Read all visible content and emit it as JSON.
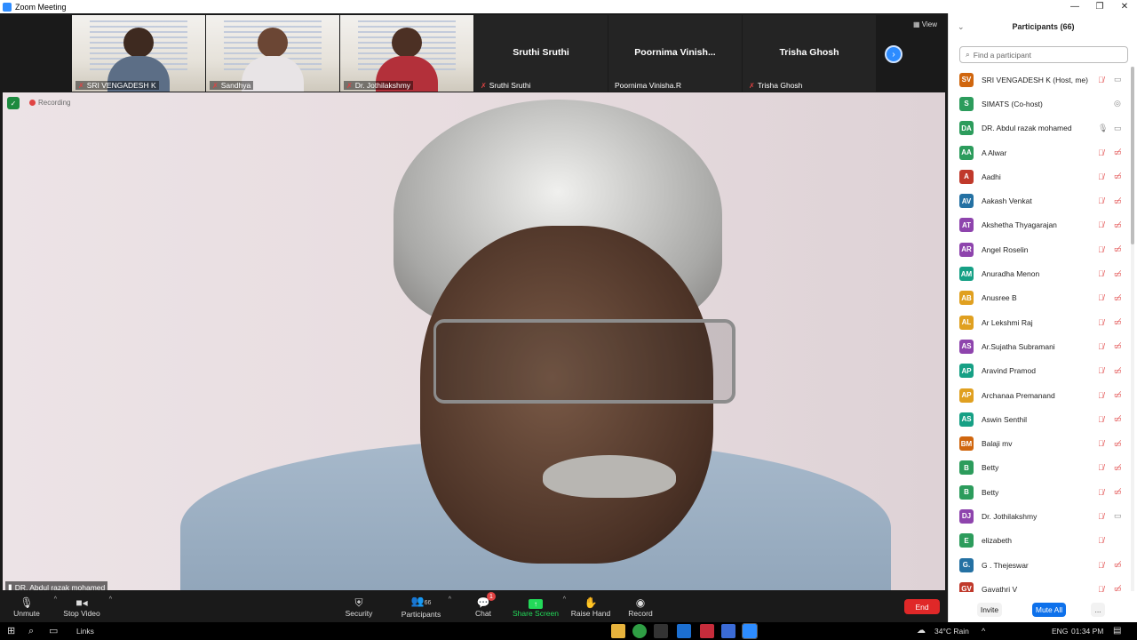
{
  "window": {
    "title": "Zoom Meeting",
    "controls": [
      "—",
      "❐",
      "✕"
    ]
  },
  "thumbnails": [
    {
      "name": "SRI VENGADESH K",
      "muted": true,
      "video": true
    },
    {
      "name": "Sandhya",
      "muted": true,
      "video": true
    },
    {
      "name": "Dr. Jothilakshmy",
      "muted": true,
      "video": true
    },
    {
      "name": "Sruthi Sruthi",
      "label": "Sruthi Sruthi",
      "muted": true,
      "video": false
    },
    {
      "name": "Poornima Vinisha.R",
      "label": "Poornima  Vinish...",
      "muted": false,
      "video": false
    },
    {
      "name": "Trisha Ghosh",
      "label": "Trisha Ghosh",
      "muted": true,
      "video": false
    }
  ],
  "view_label": "View",
  "main": {
    "speaker": "DR. Abdul razak mohamed",
    "recording": "Recording"
  },
  "toolbar": {
    "unmute": "Unmute",
    "stop_video": "Stop Video",
    "security": "Security",
    "participants": "Participants",
    "participants_count": "66",
    "chat": "Chat",
    "chat_badge": "1",
    "share_screen": "Share Screen",
    "raise_hand": "Raise Hand",
    "record": "Record",
    "end": "End"
  },
  "panel": {
    "title": "Participants (66)",
    "search_placeholder": "Find a participant",
    "participants": [
      {
        "initials": "SV",
        "name": "SRI VENGADESH K (Host, me)",
        "color": "#d0660e",
        "mic": "muted",
        "cam": "on"
      },
      {
        "initials": "S",
        "name": "SIMATS (Co-host)",
        "color": "#2c9c5c",
        "mic": "none",
        "cam": "share"
      },
      {
        "initials": "DA",
        "name": "DR. Abdul razak mohamed",
        "color": "#2c9c5c",
        "mic": "on",
        "cam": "on"
      },
      {
        "initials": "AA",
        "name": "A Alwar",
        "color": "#2c9c5c",
        "mic": "muted",
        "cam": "off"
      },
      {
        "initials": "A",
        "name": "Aadhi",
        "color": "#c0392b",
        "mic": "muted",
        "cam": "off"
      },
      {
        "initials": "AV",
        "name": "Aakash Venkat",
        "color": "#2471a3",
        "mic": "muted",
        "cam": "off"
      },
      {
        "initials": "AT",
        "name": "Akshetha Thyagarajan",
        "color": "#8e44ad",
        "mic": "muted",
        "cam": "off"
      },
      {
        "initials": "AR",
        "name": "Angel Roselin",
        "color": "#8e44ad",
        "mic": "muted",
        "cam": "off"
      },
      {
        "initials": "AM",
        "name": "Anuradha Menon",
        "color": "#16a085",
        "mic": "muted",
        "cam": "off"
      },
      {
        "initials": "AB",
        "name": "Anusree B",
        "color": "#e0a020",
        "mic": "muted",
        "cam": "off"
      },
      {
        "initials": "AL",
        "name": "Ar Lekshmi Raj",
        "color": "#e0a020",
        "mic": "muted",
        "cam": "off"
      },
      {
        "initials": "AS",
        "name": "Ar.Sujatha Subramani",
        "color": "#8e44ad",
        "mic": "muted",
        "cam": "off"
      },
      {
        "initials": "AP",
        "name": "Aravind Pramod",
        "color": "#16a085",
        "mic": "muted",
        "cam": "off"
      },
      {
        "initials": "AP",
        "name": "Archanaa Premanand",
        "color": "#e0a020",
        "mic": "muted",
        "cam": "off"
      },
      {
        "initials": "AS",
        "name": "Aswin Senthil",
        "color": "#16a085",
        "mic": "muted",
        "cam": "off"
      },
      {
        "initials": "BM",
        "name": "Balaji mv",
        "color": "#d0660e",
        "mic": "muted",
        "cam": "off"
      },
      {
        "initials": "B",
        "name": "Betty",
        "color": "#2c9c5c",
        "mic": "muted",
        "cam": "off"
      },
      {
        "initials": "B",
        "name": "Betty",
        "color": "#2c9c5c",
        "mic": "muted",
        "cam": "off"
      },
      {
        "initials": "DJ",
        "name": "Dr. Jothilakshmy",
        "color": "#8e44ad",
        "mic": "muted",
        "cam": "on"
      },
      {
        "initials": "E",
        "name": "elizabeth",
        "color": "#2c9c5c",
        "mic": "muted",
        "cam": "none"
      },
      {
        "initials": "G.",
        "name": "G . Thejeswar",
        "color": "#2471a3",
        "mic": "muted",
        "cam": "off"
      },
      {
        "initials": "GV",
        "name": "Gayathri V",
        "color": "#c0392b",
        "mic": "muted",
        "cam": "off"
      }
    ],
    "invite": "Invite",
    "mute_all": "Mute All",
    "more": "..."
  },
  "taskbar": {
    "links": "Links",
    "weather": "34°C  Rain",
    "lang": "ENG",
    "time": "01:34 PM"
  }
}
